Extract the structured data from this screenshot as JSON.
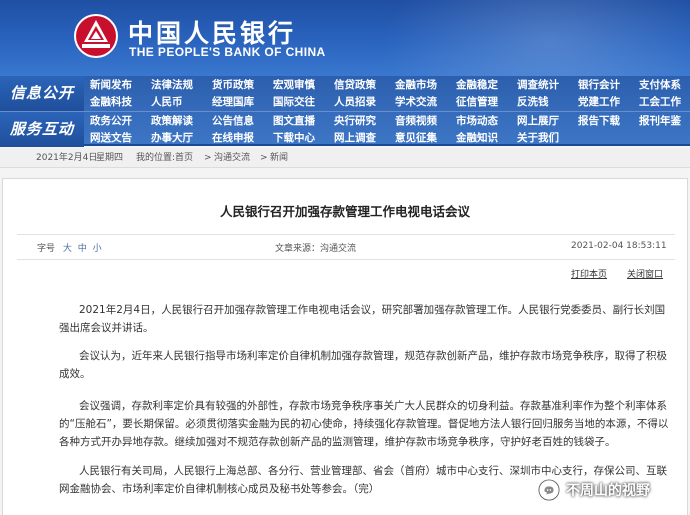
{
  "header": {
    "bank_name_cn": "中国人民银行",
    "bank_name_en": "THE PEOPLE'S BANK OF CHINA",
    "logo": "pboc-emblem-icon",
    "brand_color": "#2a5db0",
    "logo_color": "#c8102e"
  },
  "nav": {
    "section1_label": "信息公开",
    "section2_label": "服务互动",
    "row1": [
      "新闻发布",
      "法律法规",
      "货币政策",
      "宏观审慎",
      "信贷政策",
      "金融市场",
      "金融稳定",
      "调查统计",
      "银行会计",
      "支付体系"
    ],
    "row2": [
      "金融科技",
      "人民币",
      "经理国库",
      "国际交往",
      "人员招录",
      "学术交流",
      "征信管理",
      "反洗钱",
      "党建工作",
      "工会工作"
    ],
    "row3": [
      "政务公开",
      "政策解读",
      "公告信息",
      "图文直播",
      "央行研究",
      "音频视频",
      "市场动态",
      "网上展厅",
      "报告下载",
      "报刊年鉴"
    ],
    "row4": [
      "网送文告",
      "办事大厅",
      "在线申报",
      "下载中心",
      "网上调查",
      "意见征集",
      "金融知识",
      "关于我们"
    ]
  },
  "breadcrumb": {
    "date": "2021年2月4日",
    "weekday": "星期四",
    "location": "我的位置:首页",
    "sep": ">",
    "level1": "沟通交流",
    "level2": "新闻"
  },
  "article": {
    "title": "人民银行召开加强存款管理工作电视电话会议",
    "font_size_label": "字号",
    "font_sizes": [
      "大",
      "中",
      "小"
    ],
    "source_label": "文章来源：",
    "source": "沟通交流",
    "datetime": "2021-02-04 18:53:11",
    "print_label": "打印本页",
    "close_label": "关闭窗口",
    "paragraphs": [
      "2021年2月4日，人民银行召开加强存款管理工作电视电话会议，研究部署加强存款管理工作。人民银行党委委员、副行长刘国强出席会议并讲话。",
      "会议认为，近年来人民银行指导市场利率定价自律机制加强存款管理，规范存款创新产品，维护存款市场竞争秩序，取得了积极成效。",
      "会议强调，存款利率定价具有较强的外部性，存款市场竞争秩序事关广大人民群众的切身利益。存款基准利率作为整个利率体系的“压舱石”，要长期保留。必须贯彻落实金融为民的初心使命，持续强化存款管理。督促地方法人银行回归服务当地的本源，不得以各种方式开办异地存款。继续加强对不规范存款创新产品的监测管理，维护存款市场竞争秩序，守护好老百姓的钱袋子。",
      "人民银行有关司局，人民银行上海总部、各分行、营业管理部、省会（首府）城市中心支行、深圳市中心支行，存保公司、互联网金融协会、市场利率定价自律机制核心成员及秘书处等参会。（完）"
    ]
  },
  "watermark": {
    "icon": "wechat-official-account-icon",
    "text": "不周山的视野"
  }
}
